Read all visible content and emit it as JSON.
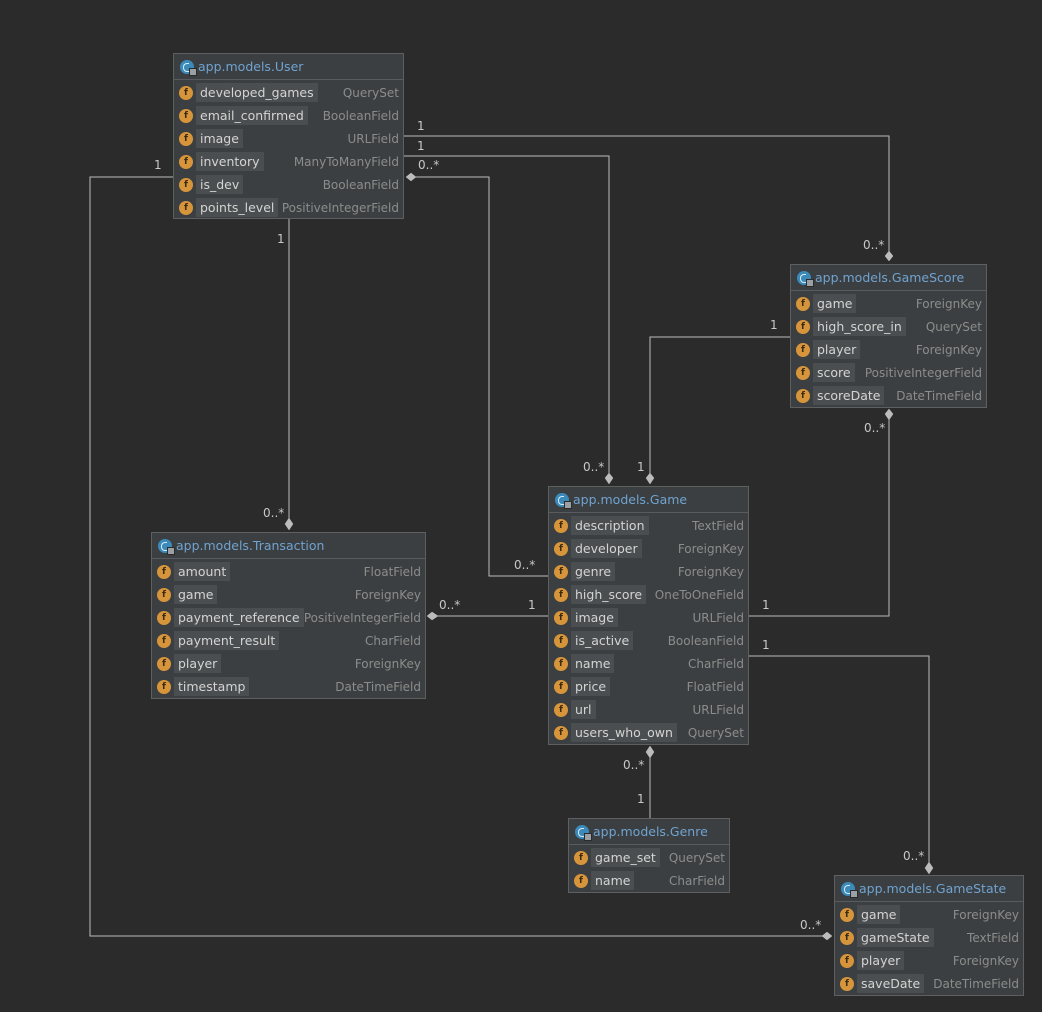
{
  "classes": {
    "user": {
      "title": "app.models.User",
      "fields": [
        {
          "name": "developed_games",
          "type": "QuerySet"
        },
        {
          "name": "email_confirmed",
          "type": "BooleanField"
        },
        {
          "name": "image",
          "type": "URLField"
        },
        {
          "name": "inventory",
          "type": "ManyToManyField"
        },
        {
          "name": "is_dev",
          "type": "BooleanField"
        },
        {
          "name": "points_level",
          "type": "PositiveIntegerField"
        }
      ]
    },
    "gamescore": {
      "title": "app.models.GameScore",
      "fields": [
        {
          "name": "game",
          "type": "ForeignKey"
        },
        {
          "name": "high_score_in",
          "type": "QuerySet"
        },
        {
          "name": "player",
          "type": "ForeignKey"
        },
        {
          "name": "score",
          "type": "PositiveIntegerField"
        },
        {
          "name": "scoreDate",
          "type": "DateTimeField"
        }
      ]
    },
    "transaction": {
      "title": "app.models.Transaction",
      "fields": [
        {
          "name": "amount",
          "type": "FloatField"
        },
        {
          "name": "game",
          "type": "ForeignKey"
        },
        {
          "name": "payment_reference",
          "type": "PositiveIntegerField"
        },
        {
          "name": "payment_result",
          "type": "CharField"
        },
        {
          "name": "player",
          "type": "ForeignKey"
        },
        {
          "name": "timestamp",
          "type": "DateTimeField"
        }
      ]
    },
    "game": {
      "title": "app.models.Game",
      "fields": [
        {
          "name": "description",
          "type": "TextField"
        },
        {
          "name": "developer",
          "type": "ForeignKey"
        },
        {
          "name": "genre",
          "type": "ForeignKey"
        },
        {
          "name": "high_score",
          "type": "OneToOneField"
        },
        {
          "name": "image",
          "type": "URLField"
        },
        {
          "name": "is_active",
          "type": "BooleanField"
        },
        {
          "name": "name",
          "type": "CharField"
        },
        {
          "name": "price",
          "type": "FloatField"
        },
        {
          "name": "url",
          "type": "URLField"
        },
        {
          "name": "users_who_own",
          "type": "QuerySet"
        }
      ]
    },
    "genre": {
      "title": "app.models.Genre",
      "fields": [
        {
          "name": "game_set",
          "type": "QuerySet"
        },
        {
          "name": "name",
          "type": "CharField"
        }
      ]
    },
    "gamestate": {
      "title": "app.models.GameState",
      "fields": [
        {
          "name": "game",
          "type": "ForeignKey"
        },
        {
          "name": "gameState",
          "type": "TextField"
        },
        {
          "name": "player",
          "type": "ForeignKey"
        },
        {
          "name": "saveDate",
          "type": "DateTimeField"
        }
      ]
    }
  },
  "field_icon_letter": "f",
  "multiplicity_labels": [
    "1",
    "1",
    "0..*",
    "1",
    "1",
    "0..*",
    "1",
    "0..*",
    "0..*",
    "1",
    "0..*",
    "0..*",
    "1",
    "0..*",
    "1",
    "1",
    "0..*",
    "1",
    "0..*",
    "0..*",
    "1"
  ],
  "colors": {
    "background": "#2b2b2b",
    "class_header_text": "#6fa3d0",
    "field_icon": "#d6953a",
    "connector": "#bcbcbc"
  },
  "icons": {
    "class": "class-icon",
    "field": "field-icon",
    "composition_end": "diamond-icon"
  }
}
